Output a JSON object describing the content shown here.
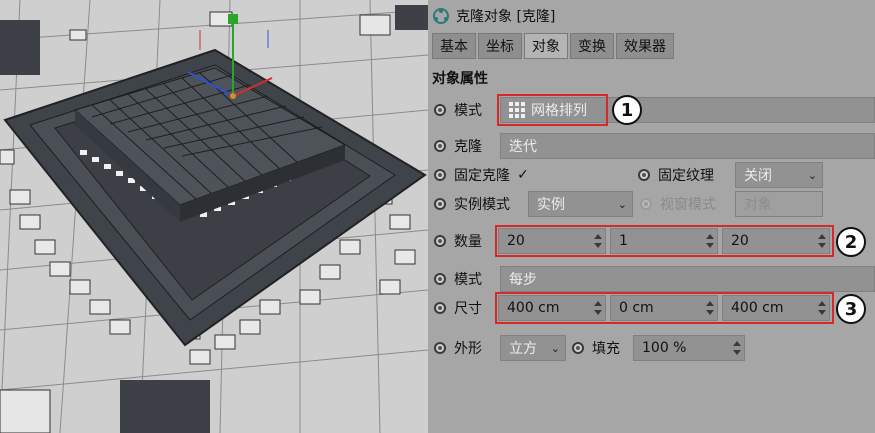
{
  "panel": {
    "title": "克隆对象 [克隆]",
    "tabs": [
      {
        "label": "基本",
        "active": false
      },
      {
        "label": "坐标",
        "active": false
      },
      {
        "label": "对象",
        "active": true
      },
      {
        "label": "变换",
        "active": false
      },
      {
        "label": "效果器",
        "active": false
      }
    ],
    "section_title": "对象属性",
    "mode": {
      "label": "模式",
      "value": "网格排列",
      "icon": "grid-icon"
    },
    "clone": {
      "label": "克隆",
      "value": "迭代"
    },
    "fixed_clone": {
      "label": "固定克隆",
      "checked": true
    },
    "fixed_texture": {
      "label": "固定纹理",
      "value": "关闭"
    },
    "instance_mode": {
      "label": "实例模式",
      "value": "实例"
    },
    "viewport_mode": {
      "label": "视窗模式",
      "value": "对象"
    },
    "count": {
      "label": "数量",
      "values": [
        "20",
        "1",
        "20"
      ]
    },
    "mode2": {
      "label": "模式",
      "value": "每步"
    },
    "size": {
      "label": "尺寸",
      "values": [
        "400 cm",
        "0 cm",
        "400 cm"
      ]
    },
    "shape": {
      "label": "外形",
      "value": "立方"
    },
    "fill": {
      "label": "填充",
      "value": "100 %"
    }
  },
  "callouts": [
    "1",
    "2",
    "3"
  ],
  "colors": {
    "highlight": "#d42a2a",
    "panel_bg": "#a6a6a6",
    "field_bg": "#929292"
  }
}
